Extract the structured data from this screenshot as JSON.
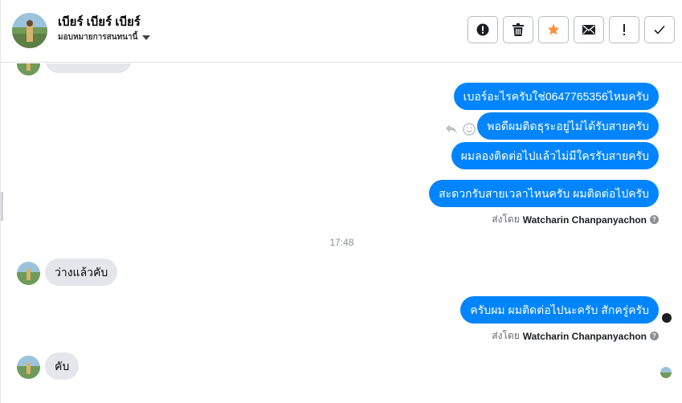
{
  "header": {
    "contact_name": "เบียร์ เบียร์ เบียร์",
    "assign_label": "มอบหมายการสนทนานี้",
    "toolbar_icons": [
      "alert-circle-icon",
      "trash-icon",
      "star-icon",
      "envelope-icon",
      "exclamation-icon",
      "check-icon"
    ]
  },
  "colors": {
    "outgoing_bubble": "#0084ff",
    "incoming_bubble": "#e4e6eb",
    "star_accent": "#f7923a"
  },
  "messages": {
    "out_1": "เบอร์อะไรครับใช่0647765356ไหมครับ",
    "out_2": "พอดีผมติดธุระอยู่ไม่ได้รับสายครับ",
    "out_3": "ผมลองติดต่อไปแล้วไม่มีใครรับสายครับ",
    "out_4": "สะดวกรับสายเวลาไหนครับ ผมติดต่อไปครับ",
    "timestamp": "17:48",
    "in_1": "ว่างแล้วคับ",
    "out_5": "ครับผม ผมติดต่อไปนะครับ สักครู่ครับ",
    "in_2": "คับ"
  },
  "sent_by": {
    "prefix": "ส่งโดย",
    "name": "Watcharin Chanpanyachon",
    "help": "?"
  }
}
